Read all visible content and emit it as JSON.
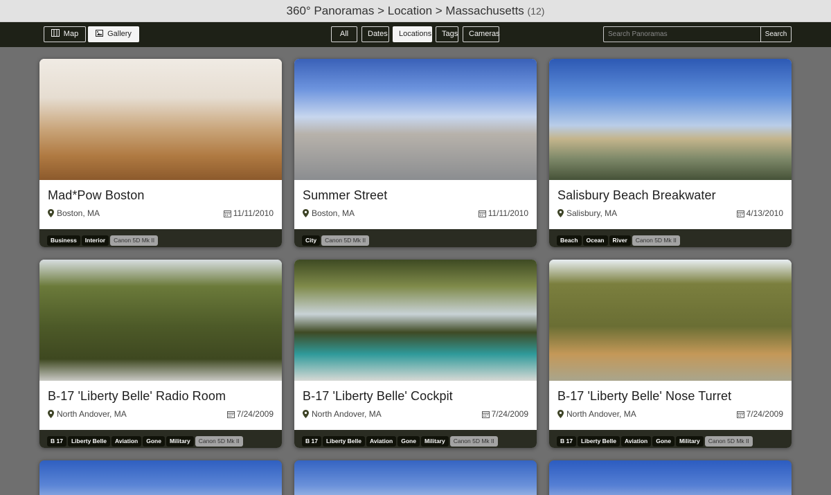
{
  "header": {
    "title": "360° Panoramas",
    "breadcrumb_sep1": " > ",
    "breadcrumb_location": "Location",
    "breadcrumb_sep2": " > ",
    "breadcrumb_state": "Massachusetts",
    "count": "(12)"
  },
  "view_toggle": {
    "map_label": "Map",
    "gallery_label": "Gallery",
    "active": "Gallery"
  },
  "filters": {
    "all": "All",
    "dates": "Dates",
    "locations": "Locations",
    "tags": "Tags",
    "cameras": "Cameras",
    "active": "Locations"
  },
  "search": {
    "placeholder": "Search Panoramas",
    "value": "",
    "button_label": "Search"
  },
  "cards": [
    {
      "name": "Mad*Pow Boston",
      "location": "Boston, MA",
      "date": "11/11/2010",
      "tags": [
        "Business",
        "Interior"
      ],
      "camera": "Canon 5D Mk II",
      "scene": "office"
    },
    {
      "name": "Summer Street",
      "location": "Boston, MA",
      "date": "11/11/2010",
      "tags": [
        "City"
      ],
      "camera": "Canon 5D Mk II",
      "scene": "street"
    },
    {
      "name": "Salisbury Beach Breakwater",
      "location": "Salisbury, MA",
      "date": "4/13/2010",
      "tags": [
        "Beach",
        "Ocean",
        "River"
      ],
      "camera": "Canon 5D Mk II",
      "scene": "beach"
    },
    {
      "name": "B-17 'Liberty Belle' Radio Room",
      "location": "North Andover, MA",
      "date": "7/24/2009",
      "tags": [
        "B 17",
        "Liberty Belle",
        "Aviation",
        "Gone",
        "Military"
      ],
      "camera": "Canon 5D Mk II",
      "scene": "radio"
    },
    {
      "name": "B-17 'Liberty Belle' Cockpit",
      "location": "North Andover, MA",
      "date": "7/24/2009",
      "tags": [
        "B 17",
        "Liberty Belle",
        "Aviation",
        "Gone",
        "Military"
      ],
      "camera": "Canon 5D Mk II",
      "scene": "cockpit"
    },
    {
      "name": "B-17 'Liberty Belle' Nose Turret",
      "location": "North Andover, MA",
      "date": "7/24/2009",
      "tags": [
        "B 17",
        "Liberty Belle",
        "Aviation",
        "Gone",
        "Military"
      ],
      "camera": "Canon 5D Mk II",
      "scene": "nose"
    }
  ],
  "partial_cards": [
    {
      "scene": "sky1"
    },
    {
      "scene": "sky2"
    },
    {
      "scene": "sky3"
    }
  ],
  "colors": {
    "nav_bg": "#1e2117",
    "page_bg": "#6f6f6f",
    "tag_bg": "#101209",
    "camera_tag_bg": "#a3a3a3",
    "tag_strip_bg": "#2a2c22"
  }
}
